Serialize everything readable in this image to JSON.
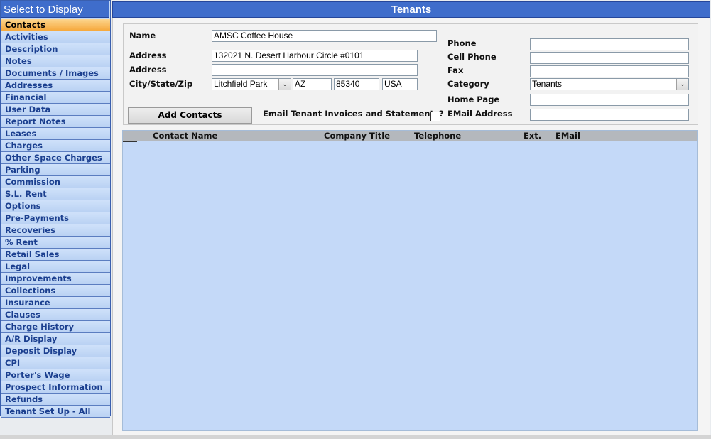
{
  "sidebar": {
    "header": "Select to Display",
    "items": [
      "Contacts",
      "Activities",
      "Description",
      "Notes",
      "Documents / Images",
      "Addresses",
      "Financial",
      "User Data",
      "Report Notes",
      "Leases",
      "Charges",
      "Other Space Charges",
      "Parking",
      "Commission",
      "S.L. Rent",
      "Options",
      "Pre-Payments",
      "Recoveries",
      "% Rent",
      "Retail Sales",
      "Legal",
      "Improvements",
      "Collections",
      "Insurance",
      "Clauses",
      "Charge History",
      "A/R Display",
      "Deposit Display",
      "CPI",
      "Porter's Wage",
      "Prospect Information",
      "Refunds",
      "Tenant Set Up - All"
    ],
    "active_index": 0
  },
  "main": {
    "title": "Tenants"
  },
  "form": {
    "name_label": "Name",
    "name_value": "AMSC Coffee House",
    "address_label": "Address",
    "address1_value": "132021 N. Desert Harbour Circle  #0101",
    "address2_label": "Address",
    "address2_value": "",
    "city_state_zip_label": "City/State/Zip",
    "city_value": "Litchfield Park",
    "state_value": "AZ",
    "zip_value": "85340",
    "country_value": "USA",
    "phone_label": "Phone",
    "phone_value": "",
    "cell_phone_label": "Cell Phone",
    "cell_phone_value": "",
    "fax_label": "Fax",
    "fax_value": "",
    "category_label": "Category",
    "category_value": "Tenants",
    "home_page_label": "Home Page",
    "home_page_value": "",
    "email_address_label": "EMail Address",
    "email_address_value": "",
    "add_contacts_label": "Add Contacts",
    "email_invoices_label": "Email Tenant Invoices and Statements?",
    "email_invoices_checked": false
  },
  "grid": {
    "columns": [
      "Contact Name",
      "Company Title",
      "Telephone",
      "Ext.",
      "EMail"
    ],
    "rows": []
  },
  "colors": {
    "header_blue": "#3f6dcb",
    "sidebar_bg": "#c3d8f5",
    "active_item": "#f6a93d",
    "grid_bg": "#c4d9f8"
  },
  "icons": {
    "dropdown": "chevron-down-icon"
  }
}
